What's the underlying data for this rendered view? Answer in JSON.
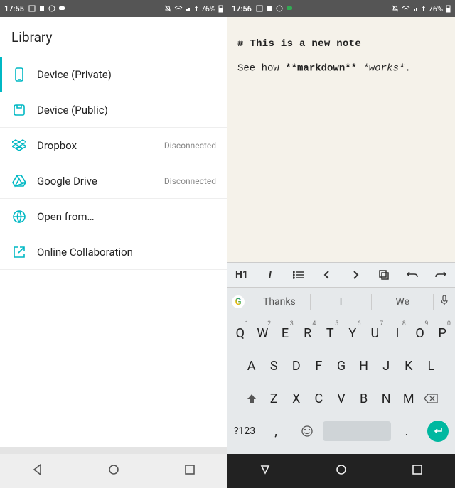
{
  "left": {
    "status": {
      "time": "17:55",
      "battery": "76%"
    },
    "header": {
      "title": "Library"
    },
    "items": [
      {
        "icon": "device-private-icon",
        "label": "Device (Private)",
        "status": "",
        "selected": true
      },
      {
        "icon": "device-public-icon",
        "label": "Device (Public)",
        "status": "",
        "selected": false
      },
      {
        "icon": "dropbox-icon",
        "label": "Dropbox",
        "status": "Disconnected",
        "selected": false
      },
      {
        "icon": "google-drive-icon",
        "label": "Google Drive",
        "status": "Disconnected",
        "selected": false
      },
      {
        "icon": "globe-icon",
        "label": "Open from…",
        "status": "",
        "selected": false
      },
      {
        "icon": "external-link-icon",
        "label": "Online Collaboration",
        "status": "",
        "selected": false
      }
    ]
  },
  "right": {
    "status": {
      "time": "17:56",
      "battery": "76%"
    },
    "editor": {
      "title_raw": "# This is a new note",
      "body_prefix": "See how ",
      "body_bold": "**markdown**",
      "body_mid": " ",
      "body_italic": "*works*",
      "body_suffix": "."
    },
    "toolbar": {
      "h1": "H1",
      "italic": "I",
      "list": "list",
      "prev": "prev",
      "next": "next",
      "copy": "copy",
      "undo": "undo",
      "redo": "redo"
    },
    "suggestions": [
      "Thanks",
      "I",
      "We"
    ],
    "keyboard": {
      "row1": [
        "Q",
        "W",
        "E",
        "R",
        "T",
        "Y",
        "U",
        "I",
        "O",
        "P"
      ],
      "nums": [
        "1",
        "2",
        "3",
        "4",
        "5",
        "6",
        "7",
        "8",
        "9",
        "0"
      ],
      "row2": [
        "A",
        "S",
        "D",
        "F",
        "G",
        "H",
        "J",
        "K",
        "L"
      ],
      "row3": [
        "Z",
        "X",
        "C",
        "V",
        "B",
        "N",
        "M"
      ],
      "sym": "?123",
      "comma": ",",
      "period": "."
    }
  }
}
